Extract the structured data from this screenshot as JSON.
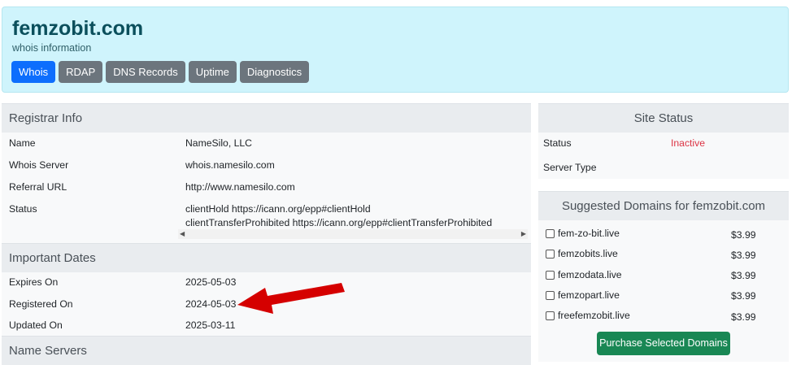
{
  "header": {
    "title": "femzobit.com",
    "subtitle": "whois information",
    "tabs": [
      "Whois",
      "RDAP",
      "DNS Records",
      "Uptime",
      "Diagnostics"
    ]
  },
  "registrar": {
    "heading": "Registrar Info",
    "rows": [
      {
        "label": "Name",
        "value": "NameSilo, LLC"
      },
      {
        "label": "Whois Server",
        "value": "whois.namesilo.com"
      },
      {
        "label": "Referral URL",
        "value": "http://www.namesilo.com"
      },
      {
        "label": "Status",
        "value": "clientHold https://icann.org/epp#clientHold",
        "value2": "clientTransferProhibited https://icann.org/epp#clientTransferProhibited"
      }
    ]
  },
  "dates": {
    "heading": "Important Dates",
    "rows": [
      {
        "label": "Expires On",
        "value": "2025-05-03"
      },
      {
        "label": "Registered On",
        "value": "2024-05-03"
      },
      {
        "label": "Updated On",
        "value": "2025-03-11"
      }
    ]
  },
  "nameservers": {
    "heading": "Name Servers"
  },
  "site_status": {
    "heading": "Site Status",
    "status_label": "Status",
    "status_value": "Inactive",
    "server_type_label": "Server Type"
  },
  "suggested": {
    "heading": "Suggested Domains for femzobit.com",
    "domains": [
      {
        "name": "fem-zo-bit.live",
        "price": "$3.99"
      },
      {
        "name": "femzobits.live",
        "price": "$3.99"
      },
      {
        "name": "femzodata.live",
        "price": "$3.99"
      },
      {
        "name": "femzopart.live",
        "price": "$3.99"
      },
      {
        "name": "freefemzobit.live",
        "price": "$3.99"
      }
    ],
    "button": "Purchase Selected Domains"
  },
  "colors": {
    "accent": "#0d6efd",
    "inactive": "#dc3545",
    "purchase": "#198754",
    "arrow": "#d50000"
  }
}
